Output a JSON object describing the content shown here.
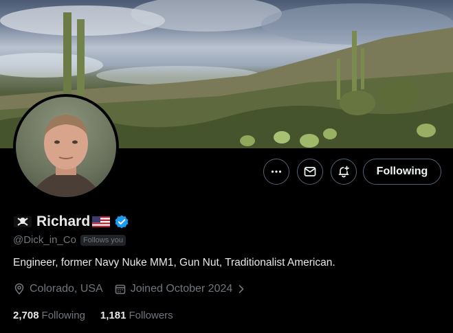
{
  "profile": {
    "display_name": "Richard",
    "name_prefix_emoji": "pirate-flag",
    "name_suffix_emoji": "us-flag",
    "verified": true,
    "handle": "@Dick_in_Co",
    "follows_you_label": "Follows you",
    "bio": "Engineer, former Navy Nuke MM1, Gun Nut, Traditionalist American.",
    "location": "Colorado, USA",
    "joined": "Joined October 2024",
    "following_count": "2,708",
    "following_label": "Following",
    "followers_count": "1,181",
    "followers_label": "Followers"
  },
  "actions": {
    "more_icon": "more-icon",
    "message_icon": "mail-icon",
    "notify_icon": "bell-plus-icon",
    "following_button_label": "Following"
  },
  "colors": {
    "background": "#000000",
    "text_primary": "#e7e9ea",
    "text_secondary": "#71767b",
    "verified_blue": "#1d9bf0",
    "button_border": "#536471"
  }
}
